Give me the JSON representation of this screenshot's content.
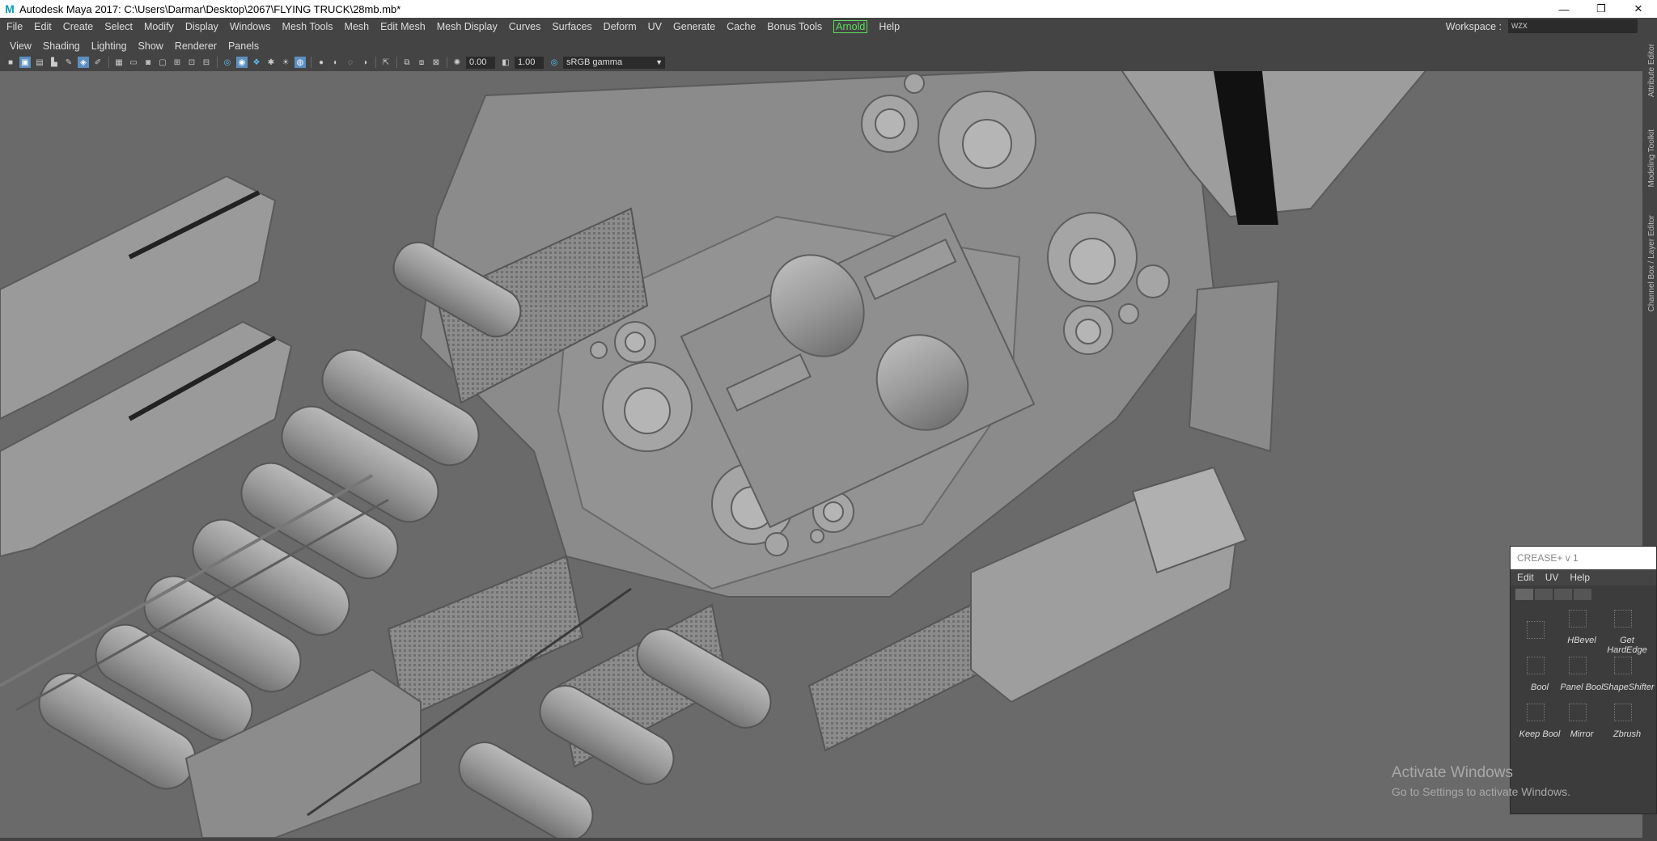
{
  "window": {
    "title": "Autodesk Maya 2017: C:\\Users\\Darmar\\Desktop\\2067\\FLYING TRUCK\\28mb.mb*",
    "minimize": "—",
    "maximize": "❐",
    "close": "✕"
  },
  "menu": [
    "File",
    "Edit",
    "Create",
    "Select",
    "Modify",
    "Display",
    "Windows",
    "Mesh Tools",
    "Mesh",
    "Edit Mesh",
    "Mesh Display",
    "Curves",
    "Surfaces",
    "Deform",
    "UV",
    "Generate",
    "Cache",
    "Bonus Tools",
    "Arnold",
    "Help"
  ],
  "workspace": {
    "label": "Workspace :",
    "value": "wzx"
  },
  "panel_menu": [
    "View",
    "Shading",
    "Lighting",
    "Show",
    "Renderer",
    "Panels"
  ],
  "toolbar": {
    "field1": "0.00",
    "field2": "1.00",
    "color_space": "sRGB gamma"
  },
  "right_tabs": [
    "Attribute Editor",
    "Modeling Toolkit",
    "Channel Box / Layer Editor"
  ],
  "crease": {
    "title": "CREASE+ v 1",
    "menu": [
      "Edit",
      "UV",
      "Help"
    ],
    "buttons": [
      "",
      "HBevel",
      "Get HardEdge",
      "Bool",
      "Panel Bool",
      "ShapeShifter",
      "Keep Bool",
      "Mirror",
      "Zbrush"
    ]
  },
  "watermark": {
    "line1": "Activate Windows",
    "line2": "Go to Settings to activate Windows."
  }
}
